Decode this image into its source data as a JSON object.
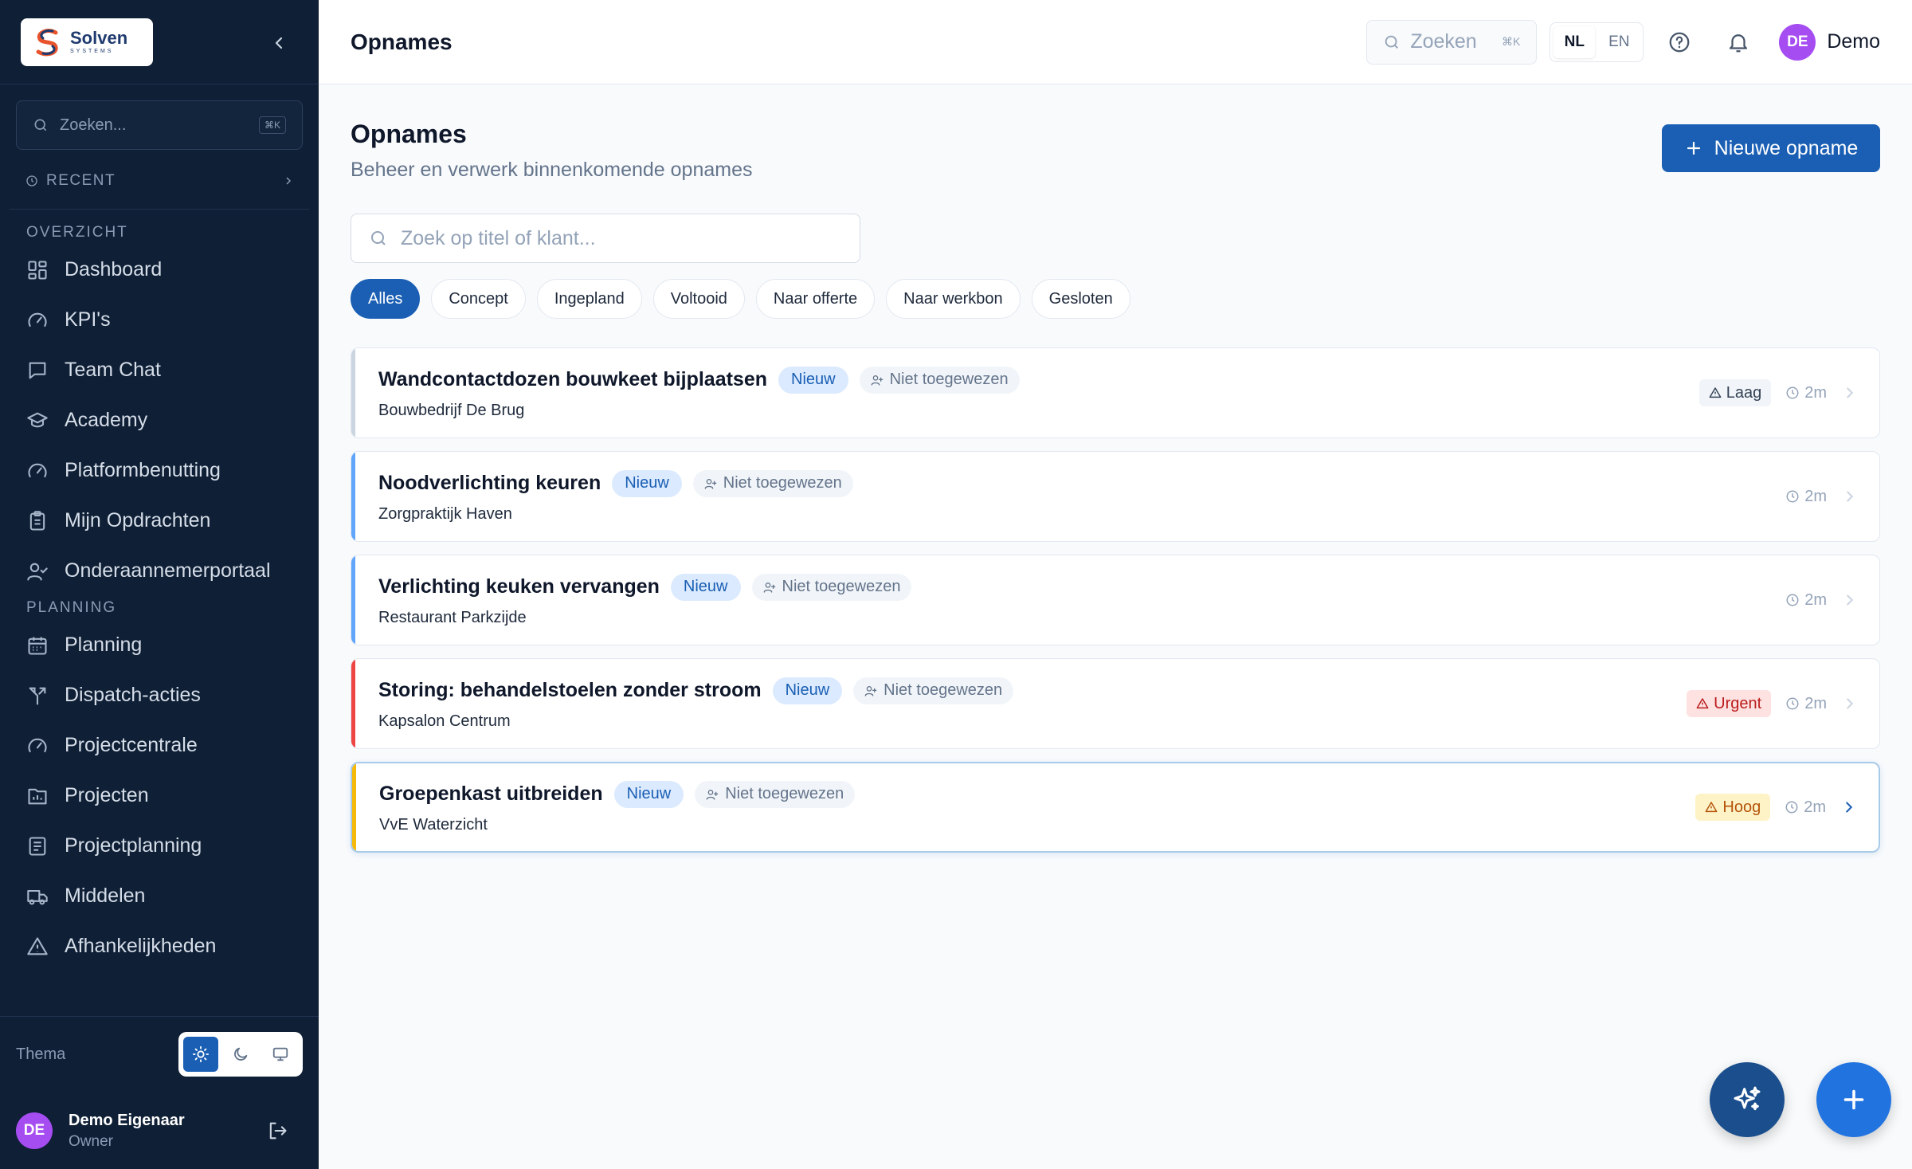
{
  "brand": {
    "name": "Solven",
    "sub": "SYSTEMS"
  },
  "sidebar": {
    "search_placeholder": "Zoeken...",
    "search_kbd": "⌘K",
    "recent_label": "RECENT",
    "sections": [
      {
        "label": "OVERZICHT",
        "items": [
          {
            "label": "Dashboard",
            "icon": "dashboard-icon"
          },
          {
            "label": "KPI's",
            "icon": "gauge-icon"
          },
          {
            "label": "Team Chat",
            "icon": "chat-icon"
          },
          {
            "label": "Academy",
            "icon": "graduation-cap-icon"
          },
          {
            "label": "Platformbenutting",
            "icon": "gauge-icon"
          },
          {
            "label": "Mijn Opdrachten",
            "icon": "clipboard-icon"
          },
          {
            "label": "Onderaannemerportaal",
            "icon": "user-check-icon"
          }
        ]
      },
      {
        "label": "PLANNING",
        "items": [
          {
            "label": "Planning",
            "icon": "calendar-icon"
          },
          {
            "label": "Dispatch-acties",
            "icon": "split-icon"
          },
          {
            "label": "Projectcentrale",
            "icon": "gauge-icon"
          },
          {
            "label": "Projecten",
            "icon": "folder-chart-icon"
          },
          {
            "label": "Projectplanning",
            "icon": "list-doc-icon"
          },
          {
            "label": "Middelen",
            "icon": "truck-icon"
          },
          {
            "label": "Afhankelijkheden",
            "icon": "warning-icon"
          }
        ]
      }
    ],
    "theme_label": "Thema",
    "user": {
      "initials": "DE",
      "name": "Demo Eigenaar",
      "role": "Owner"
    }
  },
  "topbar": {
    "title": "Opnames",
    "search_placeholder": "Zoeken",
    "search_kbd": "⌘K",
    "lang": [
      "NL",
      "EN"
    ],
    "active_lang": "NL",
    "user": {
      "initials": "DE",
      "name": "Demo"
    }
  },
  "page": {
    "title": "Opnames",
    "subtitle": "Beheer en verwerk binnenkomende opnames",
    "new_button": "Nieuwe opname",
    "search_placeholder": "Zoek op titel of klant...",
    "filters": [
      "Alles",
      "Concept",
      "Ingepland",
      "Voltooid",
      "Naar offerte",
      "Naar werkbon",
      "Gesloten"
    ],
    "active_filter": "Alles"
  },
  "items": [
    {
      "title": "Wandcontactdozen bouwkeet bijplaatsen",
      "status": "Nieuw",
      "assignee": "Niet toegewezen",
      "client": "Bouwbedrijf De Brug",
      "priority": "Laag",
      "time": "2m",
      "accent": "#cbd5e1"
    },
    {
      "title": "Noodverlichting keuren",
      "status": "Nieuw",
      "assignee": "Niet toegewezen",
      "client": "Zorgpraktijk Haven",
      "priority": "",
      "time": "2m",
      "accent": "#60a5fa"
    },
    {
      "title": "Verlichting keuken vervangen",
      "status": "Nieuw",
      "assignee": "Niet toegewezen",
      "client": "Restaurant Parkzijde",
      "priority": "",
      "time": "2m",
      "accent": "#60a5fa"
    },
    {
      "title": "Storing: behandelstoelen zonder stroom",
      "status": "Nieuw",
      "assignee": "Niet toegewezen",
      "client": "Kapsalon Centrum",
      "priority": "Urgent",
      "time": "2m",
      "accent": "#ef4444"
    },
    {
      "title": "Groepenkast uitbreiden",
      "status": "Nieuw",
      "assignee": "Niet toegewezen",
      "client": "VvE Waterzicht",
      "priority": "Hoog",
      "time": "2m",
      "accent": "#f5b90b"
    }
  ],
  "colors": {
    "primary": "#1a5fb4",
    "sidebar_bg": "#0f1f35",
    "avatar": "#a64df2"
  }
}
